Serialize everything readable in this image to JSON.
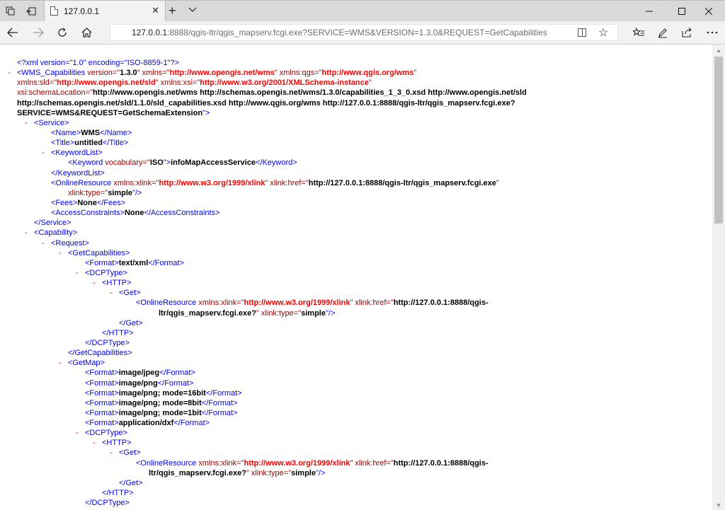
{
  "browser": {
    "tab_title": "127.0.0.1",
    "url_host": "127.0.0.1",
    "url_rest": ":8888/qgis-ltr/qgis_mapserv.fcgi.exe?SERVICE=WMS&VERSION=1.3.0&REQUEST=GetCapabilities",
    "icons": [
      "set-aside-tabs-icon",
      "show-tabs-icon",
      "page-icon",
      "close-icon",
      "new-tab-icon",
      "tab-list-icon",
      "minimize-icon",
      "maximize-icon",
      "window-close-icon",
      "back-icon",
      "forward-icon",
      "refresh-icon",
      "home-icon",
      "reading-view-icon",
      "favorite-star-icon",
      "favorites-hub-icon",
      "web-note-icon",
      "share-icon",
      "more-icon"
    ]
  },
  "xml": {
    "pi": "<?xml version=\"1.0\" encoding=\"ISO-8859-1\"?>",
    "minus": "-",
    "root_tag": "<WMS_Capabilities",
    "a_version": " version=\"",
    "version_val": "1.3.0",
    "a_xmlns": "\" xmlns=\"",
    "xmlns_val": "http://www.opengis.net/wms",
    "a_qgs": "\" xmlns:qgs=\"",
    "qgs_val": "http://www.qgis.org/wms",
    "q_close": "\"",
    "a_sld": "xmlns:sld=\"",
    "sld_val": "http://www.opengis.net/sld",
    "a_xsi": "\" xmlns:xsi=\"",
    "xsi_val": "http://www.w3.org/2001/XMLSchema-instance",
    "a_schema": "xsi:schemaLocation=\"",
    "schema_1": "http://www.opengis.net/wms http://schemas.opengis.net/wms/1.3.0/capabilities_1_3_0.xsd http://www.opengis.net/sld",
    "schema_2": "http://schemas.opengis.net/sld/1.1.0/sld_capabilities.xsd http://www.qgis.org/wms http://127.0.0.1:8888/qgis-ltr/qgis_mapserv.fcgi.exe?",
    "schema_3": "SERVICE=WMS&REQUEST=GetSchemaExtension",
    "q_gt": "\">",
    "service_open": "<Service>",
    "service_close": "</Service>",
    "name_open": "<Name>",
    "name_val": "WMS",
    "name_close": "</Name>",
    "title_open": "<Title>",
    "title_val": "untitled",
    "title_close": "</Title>",
    "keywordlist_open": "<KeywordList>",
    "keywordlist_close": "</KeywordList>",
    "keyword_open": "<Keyword",
    "a_vocab": " vocabulary=\"",
    "vocab_val": "ISO",
    "keyword_val": "infoMapAccessService",
    "keyword_close": "</Keyword>",
    "onlineres_open": "<OnlineResource",
    "a_xlink": " xmlns:xlink=\"",
    "xlink_ns_val": "http://www.w3.org/1999/xlink",
    "a_href": "\" xlink:href=\"",
    "href_full": "http://127.0.0.1:8888/qgis-ltr/qgis_mapserv.fcgi.exe",
    "href_part1": "http://127.0.0.1:8888/qgis-",
    "href_part2": "ltr/qgis_mapserv.fcgi.exe?",
    "a_type": "xlink:type=\"",
    "a_type_inline": "\" xlink:type=\"",
    "type_val": "simple",
    "self_close": "\"/>",
    "fees_open": "<Fees>",
    "fees_val": "None",
    "fees_close": "</Fees>",
    "access_open": "<AccessConstraints>",
    "access_val": "None",
    "access_close": "</AccessConstraints>",
    "capability_open": "<Capability>",
    "request_open": "<Request>",
    "getcap_open": "<GetCapabilities>",
    "getcap_close": "</GetCapabilities>",
    "format_open": "<Format>",
    "format_close": "</Format>",
    "format_xml": "text/xml",
    "dcptype_open": "<DCPType>",
    "dcptype_close": "</DCPType>",
    "http_open": "<HTTP>",
    "http_close": "</HTTP>",
    "get_open": "<Get>",
    "get_close": "</Get>",
    "getmap_open": "<GetMap>",
    "formats": [
      "image/jpeg",
      "image/png",
      "image/png; mode=16bit",
      "image/png; mode=8bit",
      "image/png; mode=1bit",
      "application/dxf"
    ]
  }
}
